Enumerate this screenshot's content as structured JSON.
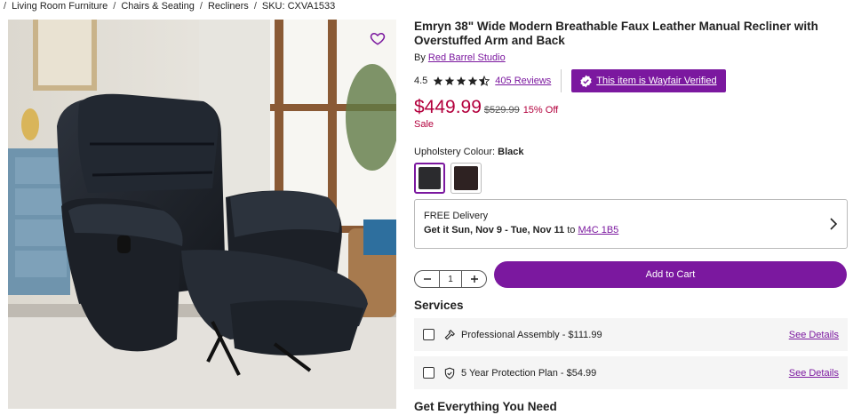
{
  "breadcrumb": {
    "items": [
      "Living Room Furniture",
      "Chairs & Seating",
      "Recliners"
    ],
    "sku": "SKU: CXVA1533"
  },
  "product": {
    "title": "Emryn 38\" Wide Modern Breathable Faux Leather Manual Recliner with Overstuffed Arm and Back",
    "by_prefix": "By",
    "brand": "Red Barrel Studio",
    "rating": "4.5",
    "rating_value": 4.5,
    "reviews": "405 Reviews",
    "verified": "This item is Wayfair Verified",
    "price": "$449.99",
    "was_price": "$529.99",
    "discount": "15% Off",
    "sale": "Sale"
  },
  "colour": {
    "label": "Upholstery Colour:",
    "value": "Black",
    "swatches": [
      {
        "name": "Black",
        "color": "#2b2b2e",
        "selected": true
      },
      {
        "name": "Brown",
        "color": "#2e2222",
        "selected": false
      }
    ]
  },
  "delivery": {
    "line1": "FREE Delivery",
    "prefix": "Get it",
    "dates": "Sun, Nov 9 - Tue, Nov 11",
    "to": "to",
    "postal": "M4C 1B5"
  },
  "cart": {
    "quantity": "1",
    "add_label": "Add to Cart"
  },
  "services": {
    "title": "Services",
    "items": [
      {
        "label": "Professional Assembly - $111.99",
        "details": "See Details",
        "icon": "hammer-icon"
      },
      {
        "label": "5 Year Protection Plan - $54.99",
        "details": "See Details",
        "icon": "shield-check-icon"
      }
    ]
  },
  "section_title": "Get Everything You Need",
  "colors": {
    "accent": "#7b189f",
    "price": "#b3003d"
  }
}
